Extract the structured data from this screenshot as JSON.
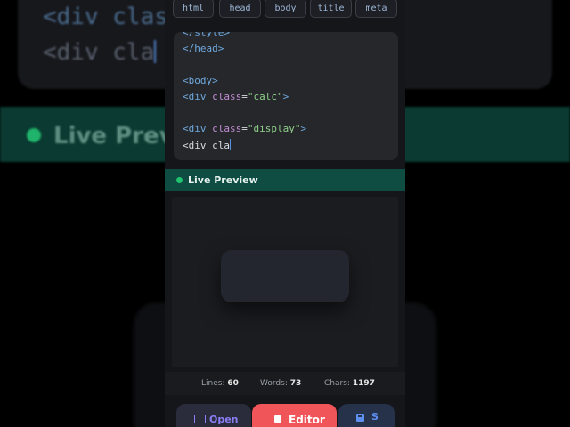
{
  "background": {
    "code_line_1": "<div clas",
    "code_line_2": "<div cla",
    "band_label": "Live Preview"
  },
  "tag_buttons": [
    "html",
    "head",
    "body",
    "title",
    "meta"
  ],
  "editor": {
    "lines": [
      [
        {
          "t": "tag",
          "v": "</style>"
        }
      ],
      [
        {
          "t": "tag",
          "v": "</head>"
        }
      ],
      [],
      [
        {
          "t": "tag",
          "v": "<body>"
        }
      ],
      [
        {
          "t": "tag",
          "v": "<div "
        },
        {
          "t": "attr",
          "v": "class"
        },
        {
          "t": "plain",
          "v": "="
        },
        {
          "t": "str",
          "v": "\"calc\""
        },
        {
          "t": "tag",
          "v": ">"
        }
      ],
      [],
      [
        {
          "t": "tag",
          "v": "<div "
        },
        {
          "t": "attr",
          "v": "class"
        },
        {
          "t": "plain",
          "v": "="
        },
        {
          "t": "str",
          "v": "\"display\""
        },
        {
          "t": "tag",
          "v": ">"
        }
      ],
      [
        {
          "t": "plain",
          "v": "<div cla"
        }
      ]
    ]
  },
  "preview": {
    "title": "Live Preview"
  },
  "stats": {
    "lines_label": "Lines:",
    "lines_value": "60",
    "words_label": "Words:",
    "words_value": "73",
    "chars_label": "Chars:",
    "chars_value": "1197"
  },
  "bottom_bar": {
    "open_label": "Open",
    "editor_label": "Editor",
    "save_label": "S"
  },
  "colors": {
    "accent_preview_header": "#0f4d43",
    "live_dot": "#22c36e",
    "editor_button": "#f0555a",
    "open_button_text": "#8a7ef5",
    "save_button_text": "#5d8ef0"
  }
}
